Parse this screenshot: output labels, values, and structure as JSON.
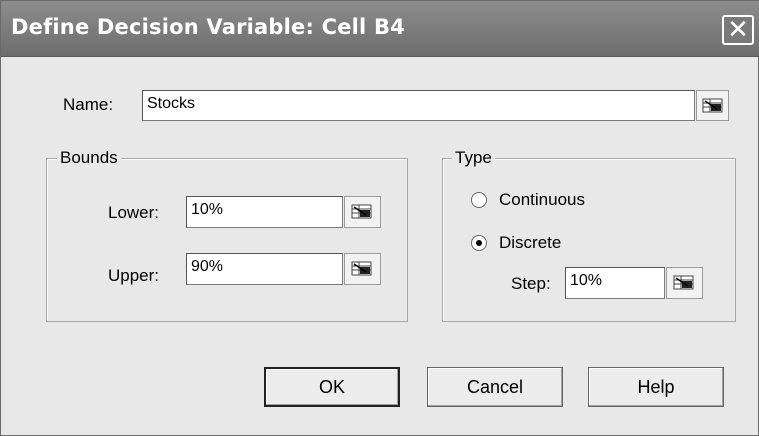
{
  "window": {
    "title": "Define Decision Variable: Cell B4",
    "close_glyph": "✕"
  },
  "name": {
    "label": "Name:",
    "value": "Stocks"
  },
  "bounds": {
    "title": "Bounds",
    "lower_label": "Lower:",
    "lower_value": "10%",
    "upper_label": "Upper:",
    "upper_value": "90%"
  },
  "type": {
    "title": "Type",
    "continuous_label": "Continuous",
    "discrete_label": "Discrete",
    "selected": "Discrete",
    "step_label": "Step:",
    "step_value": "10%"
  },
  "buttons": {
    "ok": "OK",
    "cancel": "Cancel",
    "help": "Help"
  },
  "icons": {
    "cell_picker": "cell-reference-picker-icon"
  }
}
